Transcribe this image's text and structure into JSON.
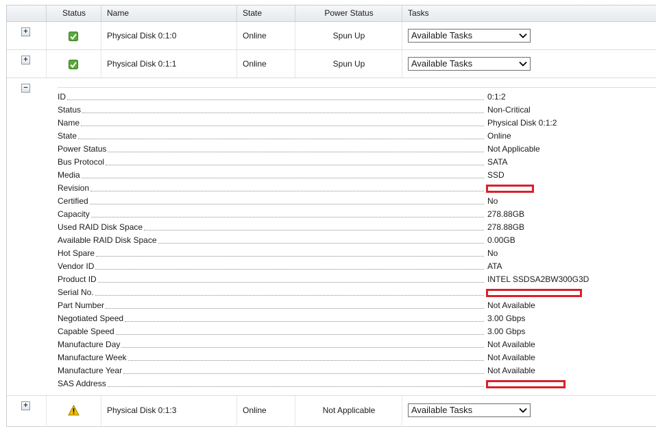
{
  "columns": {
    "status": "Status",
    "name": "Name",
    "state": "State",
    "power_status": "Power Status",
    "tasks": "Tasks"
  },
  "rows": [
    {
      "expander": "+",
      "status_icon": "ok-icon",
      "name": "Physical Disk 0:1:0",
      "state": "Online",
      "power_status": "Spun Up",
      "tasks": "Available Tasks"
    },
    {
      "expander": "+",
      "status_icon": "ok-icon",
      "name": "Physical Disk 0:1:1",
      "state": "Online",
      "power_status": "Spun Up",
      "tasks": "Available Tasks"
    },
    {
      "expander": "−"
    },
    {
      "expander": "+",
      "status_icon": "warning-icon",
      "name": "Physical Disk 0:1:3",
      "state": "Online",
      "power_status": "Not Applicable",
      "tasks": "Available Tasks"
    }
  ],
  "details": [
    {
      "label": "ID",
      "value": "0:1:2"
    },
    {
      "label": "Status",
      "value": "Non-Critical"
    },
    {
      "label": "Name",
      "value": "Physical Disk 0:1:2"
    },
    {
      "label": "State",
      "value": "Online"
    },
    {
      "label": "Power Status",
      "value": "Not Applicable"
    },
    {
      "label": "Bus Protocol",
      "value": "SATA"
    },
    {
      "label": "Media",
      "value": "SSD"
    },
    {
      "label": "Revision",
      "value": ""
    },
    {
      "label": "Certified",
      "value": "No"
    },
    {
      "label": "Capacity",
      "value": "278.88GB"
    },
    {
      "label": "Used RAID Disk Space",
      "value": "278.88GB"
    },
    {
      "label": "Available RAID Disk Space",
      "value": "0.00GB"
    },
    {
      "label": "Hot Spare",
      "value": "No"
    },
    {
      "label": "Vendor ID",
      "value": "ATA"
    },
    {
      "label": "Product ID",
      "value": "INTEL SSDSA2BW300G3D"
    },
    {
      "label": "Serial No.",
      "value": ""
    },
    {
      "label": "Part Number",
      "value": "Not Available"
    },
    {
      "label": "Negotiated Speed",
      "value": "3.00 Gbps"
    },
    {
      "label": "Capable Speed",
      "value": "3.00 Gbps"
    },
    {
      "label": "Manufacture Day",
      "value": "Not Available"
    },
    {
      "label": "Manufacture Week",
      "value": "Not Available"
    },
    {
      "label": "Manufacture Year",
      "value": "Not Available"
    },
    {
      "label": "SAS Address",
      "value": ""
    }
  ],
  "colors": {
    "redaction": "#d8202a",
    "ok_green": "#4a9a2a",
    "warning_yellow": "#f2c200"
  }
}
